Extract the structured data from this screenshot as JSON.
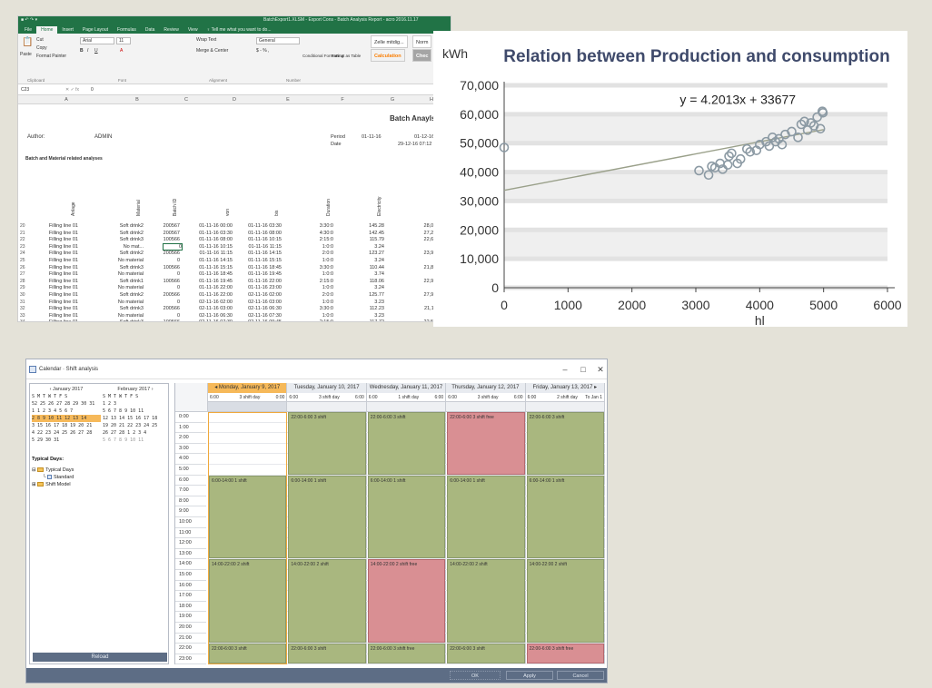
{
  "excel": {
    "window_title": "BatchExport1.XLSM - Export Cons - Batch Analysis Report - acro 2016.11.17",
    "quick_access": "■ ↶ ↷ ▾",
    "tabs": [
      "File",
      "Home",
      "Insert",
      "Page Layout",
      "Formulas",
      "Data",
      "Review",
      "View",
      "♀ Tell me what you want to do..."
    ],
    "ribbon": {
      "cut": "Cut",
      "copy": "Copy",
      "paste": "Paste",
      "format_painter": "Format Painter",
      "font_name": "Arial",
      "font_size": "11",
      "wrap_text": "Wrap Text",
      "merge_center": "Merge & Center",
      "number_format": "General",
      "conditional_formatting": "Conditional Formatting",
      "format_as_table": "Format as Table",
      "style_normal": "Zelle mitdig...",
      "style_normal2": "Norm",
      "style_calc": "Calculation",
      "style_check": "Chec",
      "groups": [
        "Clipboard",
        "Font",
        "Alignment",
        "Number"
      ]
    },
    "cell_ref": "C23",
    "formula": "0",
    "columns": [
      "A",
      "B",
      "C",
      "D",
      "E",
      "F",
      "G",
      "H"
    ],
    "report_title": "Batch Anaylse",
    "author_label": "Author:",
    "author": "ADMIN",
    "period_label": "Period",
    "period_from": "01-11-16",
    "period_to": "01-12-16",
    "date_label": "Date",
    "date_value": "29-12-16 07:12",
    "section_title": "Batch and Material related analyses",
    "col_headers": [
      "Anlage",
      "Material",
      "Batch ID",
      "von",
      "bis",
      "Duration",
      "Electricity",
      "Production"
    ],
    "row_numbers": [
      "20",
      "21",
      "22",
      "23",
      "24",
      "25",
      "26",
      "27",
      "28",
      "29",
      "30",
      "31",
      "32",
      "33",
      "34"
    ],
    "rows": [
      [
        "Filling line 01",
        "Soft drink2",
        "200567",
        "01-11-16 00:00",
        "01-11-16 03:30",
        "3:30:0",
        "145.28",
        "28,013.00"
      ],
      [
        "Filling line 01",
        "Soft drink2",
        "200567",
        "01-11-16 03:30",
        "01-11-16 08:00",
        "4:30:0",
        "142.45",
        "27,223.00"
      ],
      [
        "Filling line 01",
        "Soft drink3",
        "100566",
        "01-11-16 08:00",
        "01-11-16 10:15",
        "2:15:0",
        "115.79",
        "22,653.00"
      ],
      [
        "Filling line 01",
        "No mat...",
        "0",
        "01-11-16 10:15",
        "01-11-16 11:15",
        "1:0:0",
        "3.24",
        "0.00"
      ],
      [
        "Filling line 01",
        "Soft drink2",
        "200566",
        "01-11-16 11:15",
        "01-11-16 14:15",
        "2:0:0",
        "123.27",
        "23,940.00"
      ],
      [
        "Filling line 01",
        "No material",
        "0",
        "01-11-16 14:15",
        "01-11-16 15:15",
        "1:0:0",
        "3.24",
        "0.00"
      ],
      [
        "Filling line 01",
        "Soft drink3",
        "100566",
        "01-11-16 15:15",
        "01-11-16 18:45",
        "3:30:0",
        "110.44",
        "21,840.00"
      ],
      [
        "Filling line 01",
        "No material",
        "0",
        "01-11-16 18:45",
        "01-11-16 19:45",
        "1:0:0",
        "3.74",
        "0.00"
      ],
      [
        "Filling line 01",
        "Soft drink1",
        "100566",
        "01-11-16 19:45",
        "01-11-16 22:00",
        "2:15:0",
        "118.06",
        "22,941.00"
      ],
      [
        "Filling line 01",
        "No material",
        "0",
        "01-11-16 22:00",
        "01-11-16 23:00",
        "1:0:0",
        "3.24",
        "0.00"
      ],
      [
        "Filling line 01",
        "Soft drink2",
        "200566",
        "01-11-16 22:00",
        "02-11-16 02:00",
        "2:0:0",
        "125.77",
        "27,901.00"
      ],
      [
        "Filling line 01",
        "No material",
        "0",
        "02-11-16 02:00",
        "02-11-16 03:00",
        "1:0:0",
        "3.23",
        "0.00"
      ],
      [
        "Filling line 01",
        "Soft drink3",
        "200566",
        "02-11-16 03:00",
        "02-11-16 06:30",
        "3:30:0",
        "112.23",
        "21,112.00"
      ],
      [
        "Filling line 01",
        "No material",
        "0",
        "02-11-16 06:30",
        "02-11-16 07:30",
        "1:0:0",
        "3.23",
        "0.00"
      ],
      [
        "Filling line 01",
        "Soft drink3",
        "100566",
        "02-11-16 07:30",
        "02-11-16 09:45",
        "2:15:0",
        "117.72",
        "22,573.00"
      ]
    ]
  },
  "chart_data": {
    "type": "scatter",
    "title": "Relation between Production and consumption",
    "xlabel": "hl",
    "ylabel": "kWh",
    "xlim": [
      0,
      6000
    ],
    "ylim": [
      0,
      70000
    ],
    "xticks": [
      0,
      1000,
      2000,
      3000,
      4000,
      5000,
      6000
    ],
    "yticks": [
      0,
      10000,
      20000,
      30000,
      40000,
      50000,
      60000,
      70000
    ],
    "xtick_labels": [
      "0",
      "1000",
      "2000",
      "3000",
      "4000",
      "5000",
      "6000"
    ],
    "ytick_labels": [
      "0",
      "10,000",
      "20,000",
      "30,000",
      "40,000",
      "50,000",
      "60,000",
      "70,000"
    ],
    "grid": "horizontal bands",
    "trendline": {
      "slope": 4.2013,
      "intercept": 33677,
      "label": "y = 4.2013x + 33677"
    },
    "marker_color": "#8c9aa4",
    "trend_color": "#9aa08a",
    "points": [
      [
        0,
        48500
      ],
      [
        3050,
        40500
      ],
      [
        3200,
        39000
      ],
      [
        3250,
        42000
      ],
      [
        3300,
        41500
      ],
      [
        3380,
        43000
      ],
      [
        3420,
        41000
      ],
      [
        3500,
        42500
      ],
      [
        3520,
        45500
      ],
      [
        3560,
        46500
      ],
      [
        3650,
        43000
      ],
      [
        3700,
        44500
      ],
      [
        3800,
        48000
      ],
      [
        3850,
        47000
      ],
      [
        3950,
        47500
      ],
      [
        4000,
        49500
      ],
      [
        4100,
        50500
      ],
      [
        4150,
        49000
      ],
      [
        4200,
        52000
      ],
      [
        4250,
        50500
      ],
      [
        4300,
        51500
      ],
      [
        4350,
        49500
      ],
      [
        4400,
        53000
      ],
      [
        4500,
        54000
      ],
      [
        4600,
        52000
      ],
      [
        4650,
        56500
      ],
      [
        4700,
        57500
      ],
      [
        4750,
        54500
      ],
      [
        4800,
        57000
      ],
      [
        4850,
        56000
      ],
      [
        4900,
        59000
      ],
      [
        4950,
        55000
      ],
      [
        4980,
        61000
      ],
      [
        4990,
        60500
      ]
    ]
  },
  "calendar": {
    "title": "Calendar · Shift analysis",
    "window_controls": [
      "–",
      "□",
      "✕"
    ],
    "mini_months": [
      {
        "title": "‹   January 2017",
        "header": "  S M T W T F S",
        "rows": [
          "52 25 26 27 28 29 30 31",
          " 1  1  2  3  4  5  6  7",
          " 2  8  9 10 11 12 13 14",
          " 3 15 16 17 18 19 20 21",
          " 4 22 23 24 25 26 27 28",
          " 5 29 30 31"
        ]
      },
      {
        "title": "February 2017   ›",
        "header": "  S M T W T F S",
        "rows": [
          "            1  2  3",
          " 5  6  7  8  9 10 11",
          "12 13 14 15 16 17 18",
          "19 20 21 22 23 24 25",
          "26 27 28  1  2  3  4",
          " 5  6  7  8  9 10 11"
        ]
      }
    ],
    "typical_days_label": "Typical Days:",
    "tree": [
      "Typical Days",
      "Standard",
      "Shift Model"
    ],
    "reload_label": "Reload",
    "days": [
      {
        "label": "◂  Monday, January 9, 2017",
        "active": true,
        "shift_start": "6:00",
        "shift_name": "3 shift day",
        "shift_end": "0:00"
      },
      {
        "label": "Tuesday, January 10, 2017",
        "active": false,
        "shift_start": "6:00",
        "shift_name": "3 shift day",
        "shift_end": "6:00"
      },
      {
        "label": "Wednesday, January 11, 2017",
        "active": false,
        "shift_start": "6:00",
        "shift_name": "1 shift day",
        "shift_end": "6:00"
      },
      {
        "label": "Thursday, January 12, 2017",
        "active": false,
        "shift_start": "6:00",
        "shift_name": "3 shift day",
        "shift_end": "6:00"
      },
      {
        "label": "Friday, January 13, 2017  ▸",
        "active": false,
        "shift_start": "6:00",
        "shift_name": "2 shift day",
        "shift_end": "To Jan 1"
      }
    ],
    "hours": [
      "0:00",
      "1:00",
      "2:00",
      "3:00",
      "4:00",
      "5:00",
      "6:00",
      "7:00",
      "8:00",
      "9:00",
      "10:00",
      "11:00",
      "12:00",
      "13:00",
      "14:00",
      "15:00",
      "16:00",
      "17:00",
      "18:00",
      "19:00",
      "20:00",
      "21:00",
      "22:00",
      "23:00"
    ],
    "blocks": [
      {
        "day": 1,
        "from": 0,
        "to": 5,
        "label": "22:00-6:00 3 shift",
        "color": "green"
      },
      {
        "day": 2,
        "from": 0,
        "to": 5,
        "label": "22:00-6:00 3 shift",
        "color": "green"
      },
      {
        "day": 3,
        "from": 0,
        "to": 5,
        "label": "22:00-6:00 3 shift free",
        "color": "red"
      },
      {
        "day": 4,
        "from": 0,
        "to": 5,
        "label": "22:00-6:00 3 shift",
        "color": "green"
      },
      {
        "day": 0,
        "from": 6,
        "to": 13,
        "label": "6:00-14:00 1 shift",
        "color": "green"
      },
      {
        "day": 1,
        "from": 6,
        "to": 13,
        "label": "6:00-14:00 1 shift",
        "color": "green"
      },
      {
        "day": 2,
        "from": 6,
        "to": 13,
        "label": "6:00-14:00 1 shift",
        "color": "green"
      },
      {
        "day": 3,
        "from": 6,
        "to": 13,
        "label": "6:00-14:00 1 shift",
        "color": "green"
      },
      {
        "day": 4,
        "from": 6,
        "to": 13,
        "label": "6:00-14:00 1 shift",
        "color": "green"
      },
      {
        "day": 0,
        "from": 14,
        "to": 21,
        "label": "14:00-22:00 2 shift",
        "color": "green"
      },
      {
        "day": 1,
        "from": 14,
        "to": 21,
        "label": "14:00-22:00 2 shift",
        "color": "green"
      },
      {
        "day": 2,
        "from": 14,
        "to": 21,
        "label": "14:00-22:00 2 shift free",
        "color": "red"
      },
      {
        "day": 3,
        "from": 14,
        "to": 21,
        "label": "14:00-22:00 2 shift",
        "color": "green"
      },
      {
        "day": 4,
        "from": 14,
        "to": 21,
        "label": "14:00-22:00 2 shift",
        "color": "green"
      },
      {
        "day": 0,
        "from": 22,
        "to": 23,
        "label": "22:00-6:00 3 shift",
        "color": "green"
      },
      {
        "day": 1,
        "from": 22,
        "to": 23,
        "label": "22:00-6:00 3 shift",
        "color": "green"
      },
      {
        "day": 2,
        "from": 22,
        "to": 23,
        "label": "22:00-6:00 3 shift free",
        "color": "green"
      },
      {
        "day": 3,
        "from": 22,
        "to": 23,
        "label": "22:00-6:00 3 shift",
        "color": "green"
      },
      {
        "day": 4,
        "from": 22,
        "to": 23,
        "label": "22:00-6:00 3 shift free",
        "color": "red"
      }
    ],
    "buttons": {
      "ok": "OK",
      "apply": "Apply",
      "cancel": "Cancel"
    }
  }
}
